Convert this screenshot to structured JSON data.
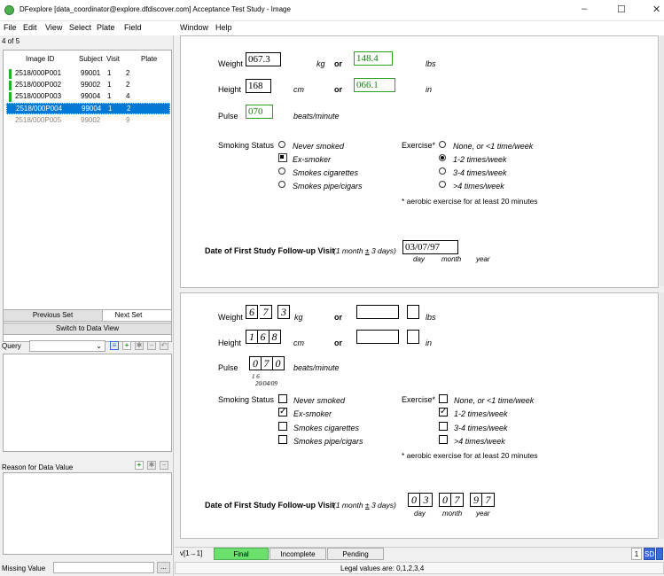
{
  "window": {
    "title": "DFexplore [data_coordinator@explore.dfdiscover.com] Acceptance Test Study - Image",
    "minimize": "–",
    "maximize": "☐",
    "close": "✕"
  },
  "menu": [
    "File",
    "Edit",
    "View",
    "Select",
    "Plate",
    "Field",
    "Window",
    "Help"
  ],
  "records": {
    "count": "4 of 5",
    "headers": [
      "Image ID",
      "Subject",
      "Visit",
      "Plate"
    ],
    "rows": [
      {
        "id": "2518/000P001",
        "subject": "99001",
        "visit": "1",
        "plate": "2"
      },
      {
        "id": "2518/000P002",
        "subject": "99002",
        "visit": "1",
        "plate": "2"
      },
      {
        "id": "2518/000P003",
        "subject": "99004",
        "visit": "1",
        "plate": "4"
      },
      {
        "id": "2518/000P004",
        "subject": "99004",
        "visit": "1",
        "plate": "2"
      },
      {
        "id": "2518/000P005",
        "subject": "99002",
        "visit": "",
        "plate": "9"
      }
    ]
  },
  "buttons": {
    "previous_set": "Previous Set",
    "next_set": "Next Set",
    "switch_view": "Switch to Data View",
    "ellipsis": "..."
  },
  "labels": {
    "query": "Query",
    "reason": "Reason for Data Value",
    "missing_value": "Missing Value"
  },
  "form": {
    "weight_label": "Weight",
    "weight_kg": "067.3",
    "kg": "kg",
    "or": "or",
    "weight_lbs": "148.4",
    "lbs": "lbs",
    "height_label": "Height",
    "height_cm": "168",
    "cm": "cm",
    "height_in": "066.1",
    "in": "in",
    "pulse_label": "Pulse",
    "pulse": "070",
    "pulse_unit": "beats/minute",
    "smoking_label": "Smoking Status",
    "smoking_options": [
      "Never smoked",
      "Ex-smoker",
      "Smokes cigarettes",
      "Smokes pipe/cigars"
    ],
    "exercise_label": "Exercise*",
    "exercise_options": [
      "None, or <1 time/week",
      "1-2 times/week",
      "3-4 times/week",
      ">4 times/week"
    ],
    "exercise_note": "* aerobic exercise for at least 20 minutes",
    "followup_label": "Date of First Study Follow-up Visit",
    "followup_hint_pre": "(1 month ",
    "followup_hint_pm": "±",
    "followup_hint_post": " 3 days)",
    "followup_date": "03/07/97",
    "day": "day",
    "month": "month",
    "year": "year",
    "weight_digits": [
      "6",
      "7",
      "3"
    ],
    "height_digits": [
      "1",
      "6",
      "8"
    ],
    "pulse_digits": [
      "0",
      "7",
      "0"
    ],
    "date_digits": [
      "0",
      "3",
      "0",
      "7",
      "9",
      "7"
    ],
    "handnote1": "1 6",
    "handnote2": "20/04/09"
  },
  "status": {
    "version": "v[1→1]",
    "final": "Final",
    "incomplete": "Incomplete",
    "pending": "Pending",
    "page": "1",
    "sd": "SD",
    "legal": "Legal values are: 0,1,2,3,4"
  },
  "colors": {
    "selection": "#0078d7",
    "green": "#1db32e",
    "final_bg": "#6ce06c"
  }
}
